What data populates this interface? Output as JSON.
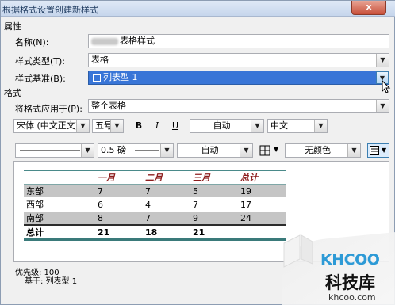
{
  "window": {
    "title": "根据格式设置创建新样式",
    "close": "x"
  },
  "properties": {
    "section_label": "属性",
    "name_label": "名称(N):",
    "name_value": "表格样式",
    "type_label": "样式类型(T):",
    "type_value": "表格",
    "based_label": "样式基准(B):",
    "based_value": "列表型 1"
  },
  "format": {
    "section_label": "格式",
    "apply_label": "将格式应用于(P):",
    "apply_value": "整个表格",
    "font": "宋体 (中文正文)",
    "size": "五号",
    "bold": "B",
    "italic": "I",
    "underline": "U",
    "font_color": "自动",
    "language": "中文",
    "line_weight": "0.5 磅",
    "border_color": "自动",
    "shading": "无颜色"
  },
  "preview": {
    "headers": [
      "",
      "一月",
      "二月",
      "三月",
      "总计"
    ],
    "rows": [
      [
        "东部",
        "7",
        "7",
        "5",
        "19"
      ],
      [
        "西部",
        "6",
        "4",
        "7",
        "17"
      ],
      [
        "南部",
        "8",
        "7",
        "9",
        "24"
      ],
      [
        "总计",
        "21",
        "18",
        "21",
        ""
      ]
    ]
  },
  "description": {
    "priority": "优先级: 100",
    "based_on": "基于: 列表型 1"
  },
  "watermark": {
    "brand": "KHCOO",
    "name": "科技库",
    "url": "khcoo.com"
  },
  "colors": {
    "selection": "#3875d7",
    "header_text": "#8c1c1c",
    "band": "#c5c5c5",
    "accent": "#3a7a7a"
  }
}
